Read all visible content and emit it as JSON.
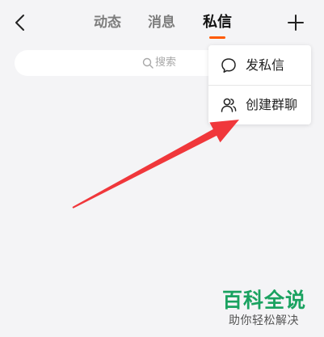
{
  "tabs": [
    {
      "label": "动态",
      "active": false
    },
    {
      "label": "消息",
      "active": false
    },
    {
      "label": "私信",
      "active": true
    }
  ],
  "accent_color": "#ff5a00",
  "search": {
    "placeholder": "搜索",
    "icon": "search-icon"
  },
  "menu": {
    "items": [
      {
        "label": "发私信",
        "icon": "chat-bubble-icon"
      },
      {
        "label": "创建群聊",
        "icon": "people-icon"
      }
    ]
  },
  "icons": {
    "back": "chevron-left-icon",
    "add": "plus-icon"
  },
  "annotation": {
    "color": "#f0373b"
  },
  "watermark": {
    "title": "百科全说",
    "subtitle": "助你轻松解决",
    "color": "#1aa260"
  }
}
